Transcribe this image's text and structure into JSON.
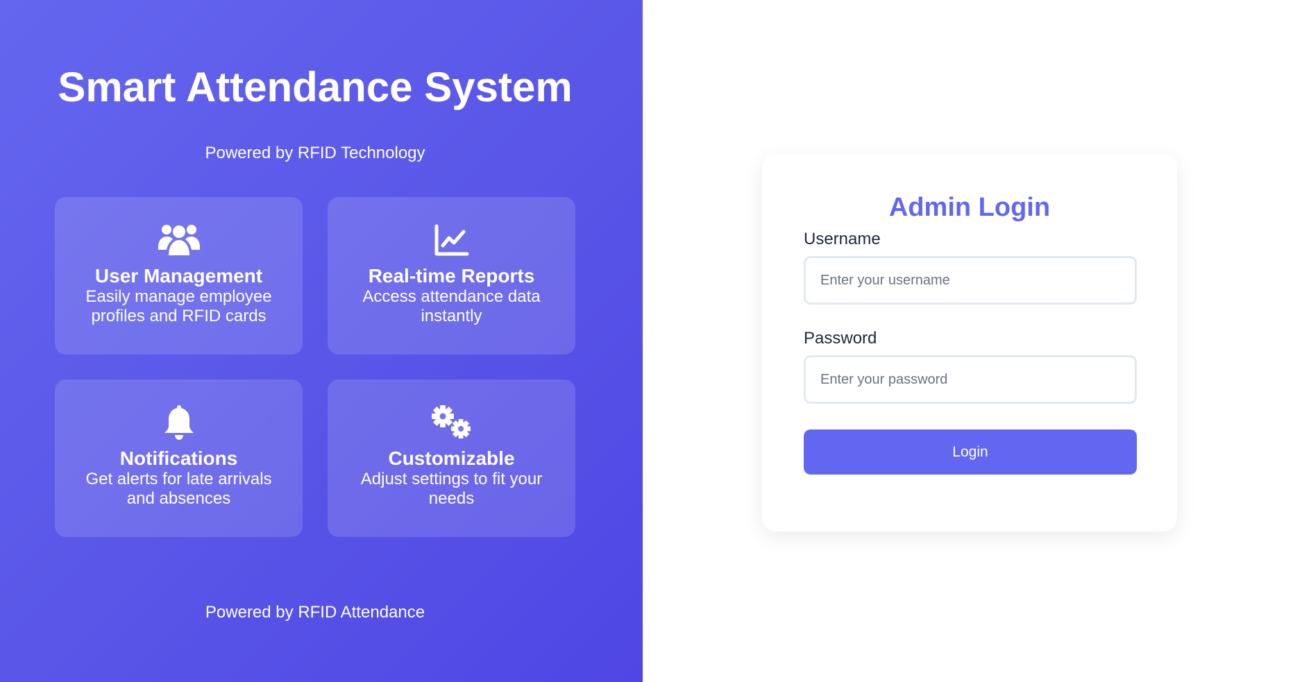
{
  "hero": {
    "title": "Smart Attendance System",
    "subtitle": "Powered by RFID Technology",
    "footer": "Powered by RFID Attendance",
    "features": [
      {
        "icon": "users-icon",
        "title": "User Management",
        "description": "Easily manage employee profiles and RFID cards"
      },
      {
        "icon": "chart-line-icon",
        "title": "Real-time Reports",
        "description": "Access attendance data instantly"
      },
      {
        "icon": "bell-icon",
        "title": "Notifications",
        "description": "Get alerts for late arrivals and absences"
      },
      {
        "icon": "gears-icon",
        "title": "Customizable",
        "description": "Adjust settings to fit your needs"
      }
    ]
  },
  "login": {
    "title": "Admin Login",
    "username_label": "Username",
    "username_placeholder": "Enter your username",
    "username_value": "",
    "password_label": "Password",
    "password_placeholder": "Enter your password",
    "password_value": "",
    "button_label": "Login"
  },
  "colors": {
    "accent": "#6366f1",
    "hero_gradient_start": "#6466ef",
    "hero_gradient_end": "#4f46e5",
    "input_border": "#e2e8f0"
  }
}
